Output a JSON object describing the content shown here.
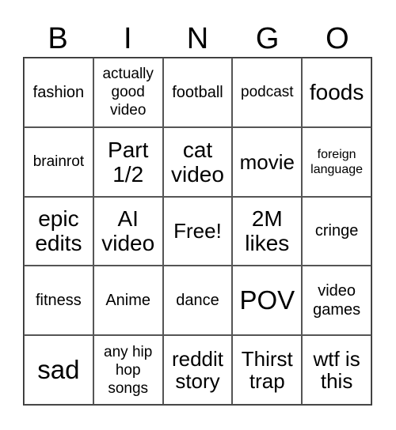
{
  "header": [
    "B",
    "I",
    "N",
    "G",
    "O"
  ],
  "cells": [
    [
      "fashion",
      "actually good video",
      "football",
      "podcast",
      "foods"
    ],
    [
      "brainrot",
      "Part 1/2",
      "cat video",
      "movie",
      "foreign language"
    ],
    [
      "epic edits",
      "AI video",
      "Free!",
      "2M likes",
      "cringe"
    ],
    [
      "fitness",
      "Anime",
      "dance",
      "POV",
      "video games"
    ],
    [
      "sad",
      "any hip hop songs",
      "reddit story",
      "Thirst trap",
      "wtf is this"
    ]
  ]
}
